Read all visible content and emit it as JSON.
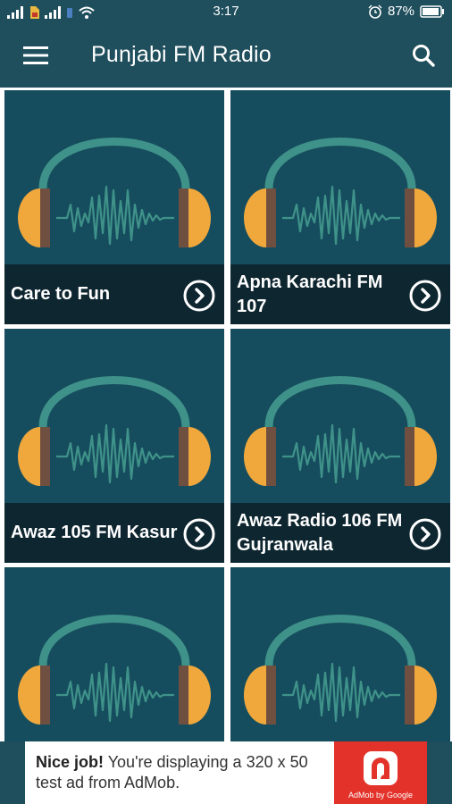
{
  "status_bar": {
    "time": "3:17",
    "battery": "87%",
    "icons": [
      "signal-icon",
      "sim-icon",
      "signal-icon",
      "wifi-icon",
      "alarm-icon",
      "battery-icon"
    ]
  },
  "app_bar": {
    "title": "Punjabi FM Radio",
    "menu_icon": "hamburger-icon",
    "search_icon": "search-icon"
  },
  "stations": [
    {
      "name": "Care to Fun"
    },
    {
      "name": "Apna Karachi FM 107"
    },
    {
      "name": "Awaz 105 FM Kasur"
    },
    {
      "name": "Awaz Radio 106 FM Gujranwala"
    },
    {
      "name": ""
    },
    {
      "name": ""
    }
  ],
  "ad": {
    "headline": "Nice job!",
    "body": " You're displaying a 320 x 50 test ad from AdMob.",
    "logo_caption": "AdMob by Google"
  },
  "colors": {
    "primary": "#1f4e5c",
    "card_bg": "#164d5e",
    "caption_bg": "#0e2630",
    "headphone_band": "#3f9289",
    "ear_cup_orange": "#f0a83c",
    "ear_cup_brown": "#6f4f40",
    "ad_red": "#e3322a"
  }
}
